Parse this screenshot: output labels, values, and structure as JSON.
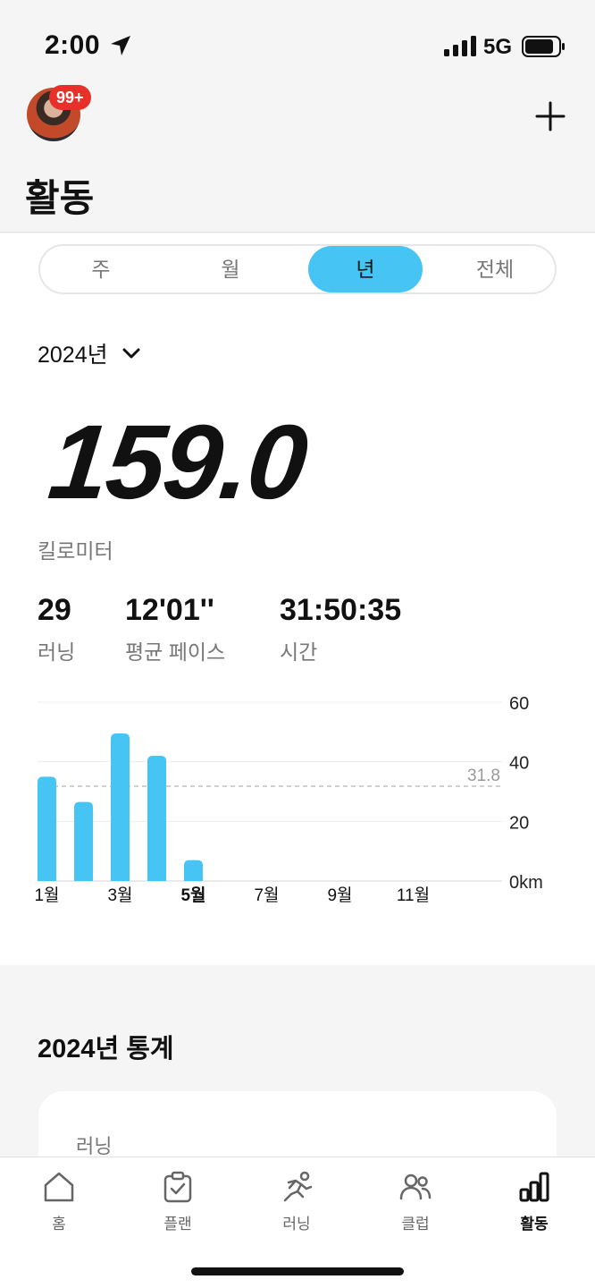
{
  "status": {
    "time": "2:00",
    "network": "5G"
  },
  "header": {
    "badge": "99+",
    "title": "활동"
  },
  "tabs": {
    "items": [
      "주",
      "월",
      "년",
      "전체"
    ],
    "selected": "년"
  },
  "year_select": "2024년",
  "summary": {
    "distance": "159.0",
    "distance_unit": "킬로미터",
    "stats": [
      {
        "value": "29",
        "label": "러닝"
      },
      {
        "value": "12'01''",
        "label": "평균 페이스"
      },
      {
        "value": "31:50:35",
        "label": "시간"
      }
    ]
  },
  "chart_data": {
    "type": "bar",
    "categories": [
      "1월",
      "2월",
      "3월",
      "4월",
      "5월",
      "6월",
      "7월",
      "8월",
      "9월",
      "10월",
      "11월",
      "12월"
    ],
    "values": [
      35,
      26.5,
      49.5,
      42,
      7,
      0,
      0,
      0,
      0,
      0,
      0,
      0
    ],
    "tick_labels_x": [
      "1월",
      "3월",
      "5월",
      "7월",
      "9월",
      "11월"
    ],
    "tick_labels_y": [
      "0km",
      "20",
      "40",
      "60"
    ],
    "ylim": [
      0,
      60
    ],
    "average_line": 31.8,
    "average_label": "31.8",
    "bar_color": "#46c5f5",
    "highlighted_month": "5월"
  },
  "stats_section": {
    "title": "2024년 통계",
    "card_label": "러닝"
  },
  "tabbar": {
    "items": [
      {
        "label": "홈",
        "icon": "home-icon"
      },
      {
        "label": "플랜",
        "icon": "plan-icon"
      },
      {
        "label": "러닝",
        "icon": "run-icon"
      },
      {
        "label": "클럽",
        "icon": "club-icon"
      },
      {
        "label": "활동",
        "icon": "activity-icon"
      }
    ],
    "active": "활동"
  },
  "colors": {
    "accent": "#46c5f5",
    "badge": "#e8302a"
  }
}
